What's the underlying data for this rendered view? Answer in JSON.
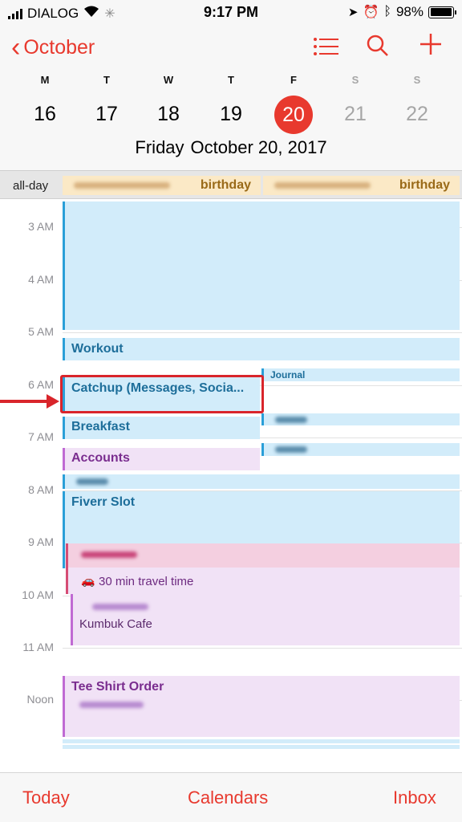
{
  "status_bar": {
    "carrier": "DIALOG",
    "time": "9:17 PM",
    "battery": "98%",
    "battery_level": 0.98,
    "icons": [
      "signal-icon",
      "wifi-icon",
      "activity-icon",
      "location-icon",
      "alarm-icon",
      "bluetooth-icon",
      "battery-icon"
    ]
  },
  "header": {
    "back_label": "October",
    "icons": [
      "list-icon",
      "search-icon",
      "add-icon"
    ]
  },
  "week": [
    {
      "letter": "M",
      "num": "16"
    },
    {
      "letter": "T",
      "num": "17"
    },
    {
      "letter": "W",
      "num": "18"
    },
    {
      "letter": "T",
      "num": "19"
    },
    {
      "letter": "F",
      "num": "20",
      "selected": true
    },
    {
      "letter": "S",
      "num": "21"
    },
    {
      "letter": "S",
      "num": "22"
    }
  ],
  "selected_date": {
    "weekday": "Friday",
    "date": "October 20, 2017"
  },
  "all_day": {
    "label": "all-day",
    "events": [
      {
        "title": "birthday"
      },
      {
        "title": "birthday"
      }
    ]
  },
  "hours": [
    "3 AM",
    "4 AM",
    "5 AM",
    "6 AM",
    "7 AM",
    "8 AM",
    "9 AM",
    "10 AM",
    "11 AM",
    "Noon"
  ],
  "events": {
    "workout": "Workout",
    "journal": "Journal",
    "catchup": "Catchup (Messages, Socia...",
    "breakfast": "Breakfast",
    "accounts": "Accounts",
    "fiverr": "Fiverr Slot",
    "travel": "30 min travel time",
    "kumbuk": "Kumbuk Cafe",
    "teeshirt": "Tee Shirt Order"
  },
  "tabbar": {
    "today": "Today",
    "calendars": "Calendars",
    "inbox": "Inbox"
  },
  "colors": {
    "accent": "#e8392e",
    "blue_event": "#d2ecfa",
    "purple_event": "#f1e2f6",
    "highlight": "#d9252b"
  }
}
